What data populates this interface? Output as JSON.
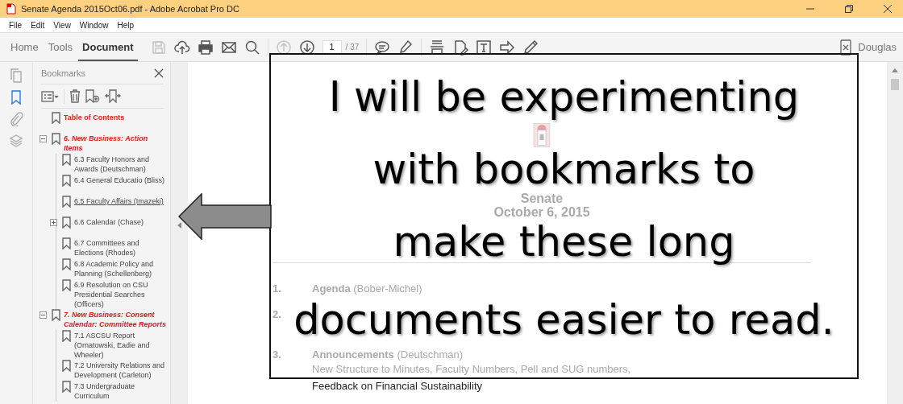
{
  "window": {
    "title": "Senate Agenda 2015Oct06.pdf - Adobe Acrobat Pro DC"
  },
  "menu": [
    "File",
    "Edit",
    "View",
    "Window",
    "Help"
  ],
  "tabs": [
    {
      "label": "Home",
      "selected": false
    },
    {
      "label": "Tools",
      "selected": false
    },
    {
      "label": "Document",
      "selected": true
    }
  ],
  "toolbar": {
    "icons": [
      {
        "kind": "save",
        "disabled": true
      },
      {
        "kind": "upload",
        "disabled": false
      },
      {
        "kind": "print",
        "disabled": false
      },
      {
        "kind": "email",
        "disabled": false
      },
      {
        "kind": "search",
        "disabled": false
      },
      {
        "kind": "sep"
      },
      {
        "kind": "prev",
        "disabled": true
      },
      {
        "kind": "next",
        "disabled": false
      },
      {
        "kind": "page"
      },
      {
        "kind": "sep"
      },
      {
        "kind": "comment",
        "disabled": false
      },
      {
        "kind": "highlight",
        "disabled": false
      },
      {
        "kind": "sep"
      },
      {
        "kind": "scan",
        "disabled": false
      },
      {
        "kind": "editpdf",
        "disabled": false
      },
      {
        "kind": "textbox",
        "disabled": false
      },
      {
        "kind": "arrow",
        "disabled": false
      },
      {
        "kind": "pencil",
        "disabled": false
      }
    ],
    "page": "1",
    "page_total": "/ 37",
    "user": "Douglas"
  },
  "side_tools": [
    {
      "kind": "pages",
      "selected": false
    },
    {
      "kind": "bookmarks",
      "selected": true
    },
    {
      "kind": "attachments",
      "selected": false
    },
    {
      "kind": "layers",
      "selected": false
    }
  ],
  "bookmarks": {
    "title": "Bookmarks",
    "items": [
      {
        "kind": "title",
        "label": "Table of Contents",
        "hovered": false
      },
      {
        "kind": "section",
        "label": "6. New Business: Action Items",
        "hovered": false,
        "expanded": true,
        "children": [
          {
            "kind": "entry",
            "label": "6.3 Faculty Honors and Awards (Deutschman)",
            "hovered": false
          },
          {
            "kind": "entry",
            "label": "6.4 General Educatio (Bliss)",
            "hovered": false
          },
          {
            "kind": "entry",
            "label": "6.5 Faculty Affairs (Imazeki)",
            "hovered": true
          },
          {
            "kind": "entry",
            "label": "6.6 Calendar (Chase)",
            "hovered": false,
            "expanded": false
          },
          {
            "kind": "entry",
            "label": "6.7 Committees and Elections (Rhodes)",
            "hovered": false
          },
          {
            "kind": "entry",
            "label": "6.8 Academic Policy and Planning (Schellenberg)",
            "hovered": false
          },
          {
            "kind": "entry",
            "label": "6.9 Resolution on CSU Presidential Searches (Officers)",
            "hovered": false
          }
        ]
      },
      {
        "kind": "section",
        "label": "7. New Business: Consent Calendar: Committee Reports",
        "hovered": false,
        "expanded": true,
        "children": [
          {
            "kind": "entry",
            "label": "7.1 ASCSU Report (Ornatowski, Eadie and Wheeler)",
            "hovered": false
          },
          {
            "kind": "entry",
            "label": "7.2 University Relations and Development (Carleton)",
            "hovered": false
          },
          {
            "kind": "entry",
            "label": "7.3 Undergraduate Curriculum",
            "hovered": false
          }
        ]
      }
    ]
  },
  "document": {
    "heading": "Senate",
    "date": "October 6, 2015",
    "agenda": [
      {
        "number": "1.",
        "title": "Agenda",
        "presenter": "(Bober-Michel)"
      },
      {
        "number": "2."
      },
      {
        "number": "3.",
        "title": "Announcements",
        "presenter": "(Deutschman)",
        "lines": [
          {
            "text": "New Structure to Minutes, Faculty Numbers, Pell and SUG numbers,",
            "faded": true
          },
          {
            "text": "Feedback on Financial Sustainability",
            "faded": false
          }
        ]
      }
    ]
  },
  "callout": {
    "lines": [
      "I will be experimenting",
      "with bookmarks to",
      "make these long",
      "documents easier to read."
    ]
  }
}
